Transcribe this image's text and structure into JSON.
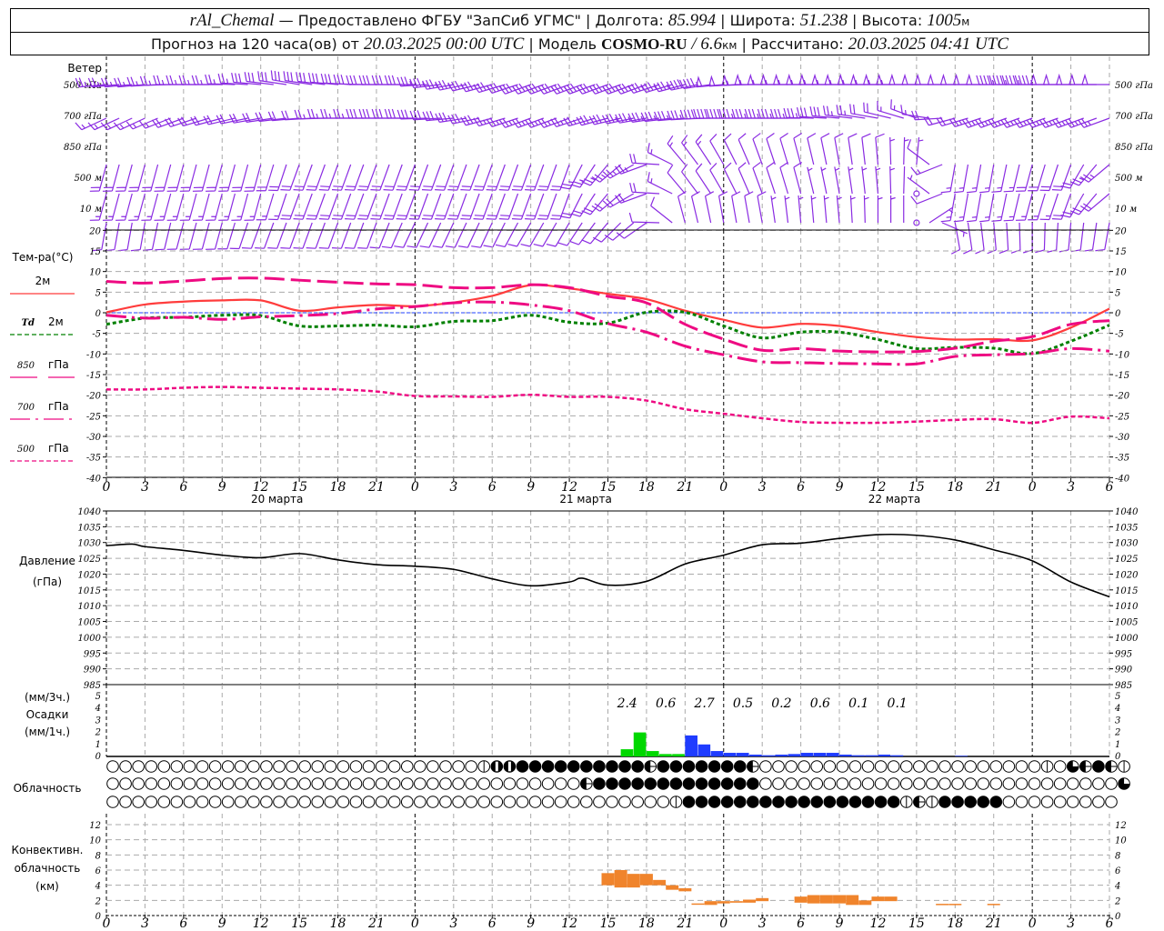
{
  "header": {
    "station": "rAl_Chemal",
    "provided": " — Предоставлено ФГБУ \"ЗапСиб УГМС\" | ",
    "lon_label": "Долгота: ",
    "lon": "85.994",
    "lat_label": " | Широта: ",
    "lat": "51.238",
    "alt_label": " | Высота: ",
    "alt": "1005",
    "alt_unit": "м",
    "forecast_prefix": "Прогноз на 120 часа(ов) от ",
    "forecast_time": "20.03.2025 00:00 UTC",
    "model_label": "  | Модель ",
    "model": "COSMO-RU",
    "resolution": " / 6.6",
    "res_unit": "км",
    "calc_label": " | Рассчитано: ",
    "calc_time": "20.03.2025 04:41 UTC"
  },
  "x_axis": {
    "hour_labels": [
      "0",
      "3",
      "6",
      "9",
      "12",
      "15",
      "18",
      "21",
      "0",
      "3",
      "6",
      "9",
      "12",
      "15",
      "18",
      "21",
      "0",
      "3",
      "6",
      "9",
      "12",
      "15",
      "18",
      "21",
      "0",
      "3",
      "6"
    ],
    "date_labels": [
      "20 марта",
      "21 марта",
      "22 марта"
    ],
    "day_boundaries": [
      0,
      24,
      48,
      72
    ]
  },
  "chart_data": [
    {
      "type": "barbs",
      "title": "Ветер",
      "levels": [
        {
          "label": "500 гПа",
          "dir": [
            265,
            265,
            270,
            270,
            275,
            280,
            275,
            270,
            270,
            260,
            255,
            250,
            250,
            250,
            250,
            255,
            265,
            270,
            270,
            270,
            270,
            270,
            270,
            270,
            270,
            270,
            270
          ],
          "speed": [
            12,
            12,
            12,
            12,
            14,
            16,
            16,
            16,
            16,
            17,
            18,
            18,
            18,
            18,
            18,
            17,
            25,
            27,
            28,
            28,
            27,
            26,
            25,
            24,
            22,
            25,
            25
          ]
        },
        {
          "label": "700 гПа",
          "dir": [
            245,
            245,
            250,
            255,
            260,
            265,
            270,
            270,
            270,
            265,
            255,
            250,
            250,
            255,
            260,
            265,
            270,
            270,
            270,
            275,
            280,
            290,
            255,
            250,
            250,
            250,
            250
          ],
          "speed": [
            8,
            8,
            9,
            9,
            10,
            10,
            12,
            14,
            16,
            16,
            14,
            12,
            12,
            14,
            18,
            18,
            20,
            18,
            18,
            15,
            10,
            8,
            10,
            12,
            12,
            12,
            12
          ]
        },
        {
          "label": "850 гПа",
          "dir": [
            195,
            195,
            195,
            195,
            195,
            200,
            200,
            200,
            200,
            200,
            200,
            200,
            200,
            220,
            250,
            320,
            330,
            340,
            345,
            350,
            355,
            5,
            190,
            190,
            195,
            200,
            230
          ],
          "speed": [
            9,
            9,
            9,
            9,
            9,
            10,
            10,
            10,
            10,
            10,
            11,
            11,
            11,
            12,
            12,
            7,
            6,
            6,
            5,
            4,
            4,
            3,
            8,
            8,
            9,
            10,
            12
          ]
        },
        {
          "label": "500 м",
          "dir": [
            195,
            195,
            195,
            195,
            195,
            200,
            200,
            200,
            200,
            200,
            200,
            200,
            200,
            220,
            250,
            320,
            330,
            340,
            345,
            350,
            355,
            5,
            190,
            190,
            195,
            200,
            230
          ],
          "speed": [
            8,
            8,
            8,
            8,
            8,
            9,
            9,
            9,
            9,
            9,
            10,
            10,
            10,
            11,
            11,
            6,
            5,
            5,
            4,
            3,
            3,
            0,
            7,
            7,
            8,
            9,
            11
          ]
        },
        {
          "label": "10  м",
          "dir": [
            190,
            190,
            195,
            195,
            200,
            200,
            200,
            200,
            205,
            205,
            205,
            210,
            210,
            220,
            235,
            345,
            350,
            350,
            355,
            355,
            0,
            0,
            170,
            175,
            180,
            185,
            190
          ],
          "speed": [
            4,
            4,
            4,
            5,
            5,
            5,
            5,
            5,
            5,
            6,
            6,
            6,
            6,
            6,
            6,
            4,
            4,
            4,
            3,
            3,
            3,
            0,
            4,
            4,
            4,
            4,
            4
          ]
        }
      ],
      "color": "#8a2be2"
    },
    {
      "type": "line",
      "ylabel": "Тем-ра(°С)",
      "ylim": [
        -40,
        20
      ],
      "yticks": [
        20,
        15,
        10,
        5,
        0,
        -5,
        -10,
        -15,
        -20,
        -25,
        -30,
        -35,
        -40
      ],
      "x": [
        0,
        3,
        6,
        9,
        12,
        15,
        18,
        21,
        24,
        27,
        30,
        33,
        36,
        39,
        42,
        45,
        48,
        51,
        54,
        57,
        60,
        63,
        66,
        69,
        72,
        75,
        78
      ],
      "series": [
        {
          "name": "2м",
          "prefix": "",
          "color": "#ff3c3c",
          "style": "solid",
          "values": [
            0.1,
            2.0,
            2.7,
            3.0,
            3.0,
            0.5,
            1.3,
            1.9,
            1.6,
            2.5,
            4.1,
            6.7,
            5.9,
            4.6,
            3.3,
            0.5,
            -1.7,
            -3.6,
            -2.7,
            -3.2,
            -4.7,
            -5.9,
            -6.5,
            -6.4,
            -6.7,
            -3.6,
            1.0
          ]
        },
        {
          "name": "2м",
          "prefix": "Td",
          "color": "#008000",
          "style": "dotted",
          "values": [
            -2.8,
            -1.3,
            -1.1,
            -0.6,
            -0.7,
            -3.2,
            -3.2,
            -3.0,
            -3.4,
            -2.1,
            -1.9,
            -0.6,
            -2.3,
            -2.5,
            0.1,
            0.1,
            -3.2,
            -6.1,
            -4.7,
            -4.7,
            -6.5,
            -8.7,
            -8.4,
            -8.6,
            -9.9,
            -6.9,
            -3.0
          ]
        },
        {
          "name": "гПа",
          "prefix": "850",
          "color": "#ee0a82",
          "style": "long",
          "values": [
            7.6,
            7.2,
            7.7,
            8.3,
            8.4,
            7.9,
            7.4,
            7.0,
            6.8,
            6.1,
            6.1,
            6.8,
            6.1,
            4.0,
            2.4,
            -2.8,
            -6.4,
            -9.1,
            -8.7,
            -9.3,
            -9.5,
            -9.4,
            -8.6,
            -6.9,
            -5.8,
            -2.8,
            -1.9
          ]
        },
        {
          "name": "гПа",
          "prefix": "700",
          "color": "#ee0a82",
          "style": "dashdot",
          "values": [
            -0.6,
            -1.3,
            -1.1,
            -1.6,
            -1.0,
            -0.7,
            -0.2,
            0.9,
            1.5,
            2.4,
            2.6,
            1.9,
            0.5,
            -2.6,
            -4.7,
            -8.1,
            -10.2,
            -11.9,
            -12.1,
            -12.3,
            -12.4,
            -12.4,
            -10.6,
            -10.2,
            -9.9,
            -8.7,
            -9.3
          ]
        },
        {
          "name": "гПа",
          "prefix": "500",
          "color": "#ee0a82",
          "style": "short",
          "values": [
            -18.6,
            -18.6,
            -18.2,
            -18.0,
            -18.2,
            -18.4,
            -18.6,
            -19.1,
            -20.2,
            -20.3,
            -20.4,
            -19.9,
            -20.4,
            -20.4,
            -21.3,
            -23.4,
            -24.5,
            -25.6,
            -26.5,
            -26.7,
            -26.7,
            -26.4,
            -26.0,
            -25.8,
            -26.7,
            -25.2,
            -25.6
          ]
        }
      ],
      "zero_line_color": "#2040ff",
      "grid": true
    },
    {
      "type": "line",
      "ylabel": "Давление",
      "yunit": "(гПа)",
      "ylim": [
        985,
        1040
      ],
      "yticks": [
        1040,
        1035,
        1030,
        1025,
        1020,
        1015,
        1010,
        1005,
        1000,
        995,
        990,
        985
      ],
      "x": [
        0,
        2,
        3,
        6,
        9,
        12,
        15,
        18,
        21,
        24,
        27,
        30,
        33,
        36,
        37,
        39,
        42,
        45,
        48,
        51,
        54,
        57,
        60,
        63,
        66,
        69,
        72,
        75,
        78
      ],
      "values": [
        1029.0,
        1029.5,
        1028.7,
        1027.5,
        1026.0,
        1025.2,
        1026.5,
        1024.5,
        1023.0,
        1022.5,
        1021.5,
        1018.5,
        1016.3,
        1017.5,
        1018.7,
        1016.5,
        1017.7,
        1023.2,
        1026.0,
        1029.3,
        1029.8,
        1031.3,
        1032.5,
        1032.3,
        1030.8,
        1027.7,
        1024.2,
        1017.5,
        1012.8
      ],
      "color": "#000000",
      "grid": true
    },
    {
      "type": "bar",
      "ylabel": "Осадки",
      "ylabel_top": "(мм/3ч.)",
      "ylabel_bottom": "(мм/1ч.)",
      "ylim": [
        0,
        5
      ],
      "yticks": [
        5,
        4,
        3,
        2,
        1,
        0
      ],
      "hours": [
        40,
        41,
        42,
        43,
        44,
        45,
        46,
        47,
        48,
        49,
        50,
        51,
        52,
        53,
        54,
        55,
        56,
        57,
        58,
        59,
        60,
        61,
        66
      ],
      "values": [
        0.6,
        2.0,
        0.45,
        0.2,
        0.2,
        1.75,
        1.0,
        0.45,
        0.3,
        0.3,
        0.15,
        0.1,
        0.15,
        0.2,
        0.3,
        0.3,
        0.3,
        0.15,
        0.1,
        0.1,
        0.15,
        0.1,
        0.05
      ],
      "types": [
        "g",
        "g",
        "g",
        "g",
        "g",
        "b",
        "b",
        "b",
        "b",
        "b",
        "b",
        "b",
        "b",
        "b",
        "b",
        "b",
        "b",
        "b",
        "b",
        "b",
        "b",
        "b",
        "b"
      ],
      "colors": {
        "g": "#00d800",
        "b": "#1f3cff"
      },
      "totals_3h": [
        {
          "start": 39,
          "value": "2.4"
        },
        {
          "start": 42,
          "value": "0.6"
        },
        {
          "start": 45,
          "value": "2.7"
        },
        {
          "start": 48,
          "value": "0.5"
        },
        {
          "start": 51,
          "value": "0.2"
        },
        {
          "start": 54,
          "value": "0.6"
        },
        {
          "start": 57,
          "value": "0.1"
        },
        {
          "start": 60,
          "value": "0.1"
        }
      ]
    },
    {
      "type": "table",
      "ylabel": "Облачность",
      "legend": {
        "o": "clear",
        "v": "half (vertical)",
        "b": "mostly overcast",
        "f": "overcast",
        "h": "partial",
        "t": "three-quarter"
      },
      "rows": [
        "ooooooooooooooooooooooooooooovbbffffffffffhfffffffhoooooooooooooooooooooovothfhv",
        "ooooooooooooooooooooooooooooooooooooohfffffffffffffoooooooooooooooooooooooooooot",
        "oooooooooooooooooooooooooooooooooooooooooooovfffffffffffffffffvhvfffffooooooooo"
      ]
    },
    {
      "type": "bar",
      "subtype": "range",
      "ylabel": "Конвективн.",
      "ylabel2": "облачность",
      "yunit": "(км)",
      "ylim": [
        0,
        12
      ],
      "yticks": [
        12,
        10,
        8,
        6,
        4,
        2,
        0
      ],
      "hours": [
        39,
        40,
        41,
        42,
        43,
        44,
        45,
        46,
        47,
        48,
        49,
        50,
        51,
        54,
        55,
        56,
        57,
        58,
        59,
        60,
        61,
        65,
        66,
        69
      ],
      "bottom": [
        4.0,
        3.7,
        3.7,
        4.0,
        4.0,
        3.4,
        3.2,
        1.5,
        1.4,
        1.6,
        1.7,
        1.7,
        1.9,
        1.7,
        1.6,
        1.6,
        1.6,
        1.4,
        1.4,
        1.9,
        1.9,
        1.4,
        1.4,
        1.4
      ],
      "top": [
        5.6,
        6.0,
        5.5,
        5.5,
        4.7,
        4.0,
        3.6,
        1.6,
        1.9,
        1.9,
        1.9,
        2.1,
        2.3,
        2.5,
        2.7,
        2.7,
        2.7,
        2.7,
        2.0,
        2.5,
        2.5,
        1.55,
        1.55,
        1.55
      ],
      "color": "#f0842c"
    }
  ]
}
